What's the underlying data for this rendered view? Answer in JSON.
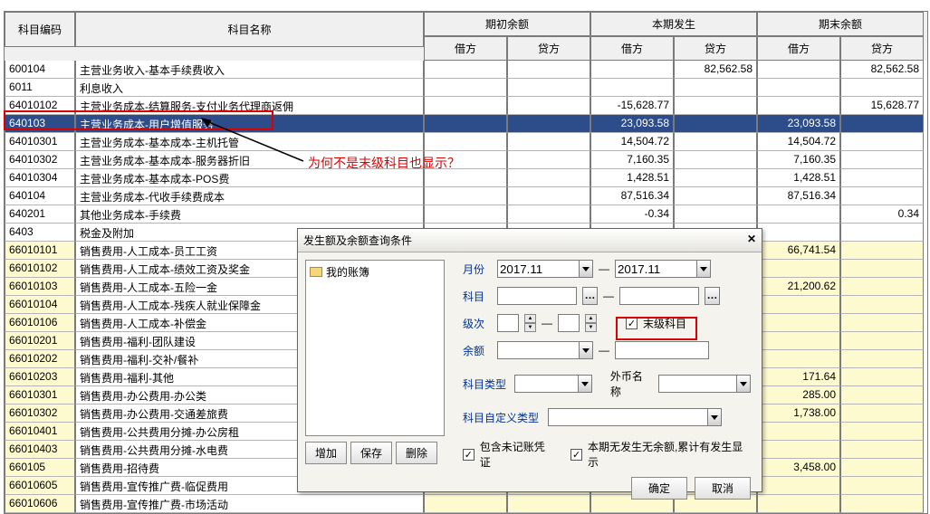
{
  "headers": {
    "code": "科目编码",
    "name": "科目名称",
    "qc": "期初余额",
    "bf": "本期发生",
    "qm": "期末余额",
    "debit": "借方",
    "credit": "贷方"
  },
  "rows": [
    {
      "code": "600104",
      "name": "    主营业务收入-基本手续费收入",
      "c": "white",
      "v": [
        "",
        "",
        "",
        "82,562.58",
        "",
        "82,562.58"
      ]
    },
    {
      "code": "6011",
      "name": "利息收入",
      "c": "white",
      "v": [
        "",
        "",
        "",
        "",
        "",
        ""
      ]
    },
    {
      "code": "64010102",
      "name": "       主营业务成本-结算服务-支付业务代理商返佣",
      "c": "white",
      "v": [
        "",
        "",
        "-15,628.77",
        "",
        "",
        "15,628.77"
      ]
    },
    {
      "code": "640103",
      "name": "    主营业务成本-用户增值服务",
      "c": "selected",
      "v": [
        "",
        "",
        "23,093.58",
        "",
        "23,093.58",
        ""
      ]
    },
    {
      "code": "64010301",
      "name": "       主营业务成本-基本成本-主机托管",
      "c": "white",
      "v": [
        "",
        "",
        "14,504.72",
        "",
        "14,504.72",
        ""
      ]
    },
    {
      "code": "64010302",
      "name": "       主营业务成本-基本成本-服务器折旧",
      "c": "white",
      "v": [
        "",
        "",
        "7,160.35",
        "",
        "7,160.35",
        ""
      ]
    },
    {
      "code": "64010304",
      "name": "       主营业务成本-基本成本-POS费",
      "c": "white",
      "v": [
        "",
        "",
        "1,428.51",
        "",
        "1,428.51",
        ""
      ]
    },
    {
      "code": "640104",
      "name": "    主营业务成本-代收手续费成本",
      "c": "white",
      "v": [
        "",
        "",
        "87,516.34",
        "",
        "87,516.34",
        ""
      ]
    },
    {
      "code": "640201",
      "name": "    其他业务成本-手续费",
      "c": "white",
      "v": [
        "",
        "",
        "-0.34",
        "",
        "",
        "0.34"
      ]
    },
    {
      "code": "6403",
      "name": "税金及附加",
      "c": "white",
      "v": [
        "",
        "",
        "",
        "",
        "",
        ""
      ]
    },
    {
      "code": "66010101",
      "name": "       销售费用-人工成本-员工工资",
      "c": "yellow",
      "v": [
        "",
        "",
        "",
        "",
        "66,741.54",
        ""
      ]
    },
    {
      "code": "66010102",
      "name": "       销售费用-人工成本-绩效工资及奖金",
      "c": "yellow",
      "v": [
        "",
        "",
        "",
        "",
        "",
        ""
      ]
    },
    {
      "code": "66010103",
      "name": "       销售费用-人工成本-五险一金",
      "c": "yellow",
      "v": [
        "",
        "",
        "",
        "",
        "21,200.62",
        ""
      ]
    },
    {
      "code": "66010104",
      "name": "       销售费用-人工成本-残疾人就业保障金",
      "c": "yellow",
      "v": [
        "",
        "",
        "",
        "",
        "",
        ""
      ]
    },
    {
      "code": "66010106",
      "name": "       销售费用-人工成本-补偿金",
      "c": "yellow",
      "v": [
        "",
        "",
        "",
        "",
        "",
        ""
      ]
    },
    {
      "code": "66010201",
      "name": "       销售费用-福利-团队建设",
      "c": "yellow",
      "v": [
        "",
        "",
        "",
        "",
        "",
        ""
      ]
    },
    {
      "code": "66010202",
      "name": "       销售费用-福利-交补/餐补",
      "c": "yellow",
      "v": [
        "",
        "",
        "",
        "",
        "",
        ""
      ]
    },
    {
      "code": "66010203",
      "name": "       销售费用-福利-其他",
      "c": "yellow",
      "v": [
        "",
        "",
        "",
        "",
        "171.64",
        ""
      ]
    },
    {
      "code": "66010301",
      "name": "       销售费用-办公费用-办公类",
      "c": "yellow",
      "v": [
        "",
        "",
        "",
        "",
        "285.00",
        ""
      ]
    },
    {
      "code": "66010302",
      "name": "       销售费用-办公费用-交通差旅费",
      "c": "yellow",
      "v": [
        "",
        "",
        "",
        "",
        "1,738.00",
        ""
      ]
    },
    {
      "code": "66010401",
      "name": "       销售费用-公共费用分摊-办公房租",
      "c": "yellow",
      "v": [
        "",
        "",
        "",
        "",
        "",
        ""
      ]
    },
    {
      "code": "66010403",
      "name": "       销售费用-公共费用分摊-水电费",
      "c": "yellow",
      "v": [
        "",
        "",
        "",
        "",
        "",
        ""
      ]
    },
    {
      "code": "660105",
      "name": "    销售费用-招待费",
      "c": "yellow",
      "v": [
        "",
        "",
        "",
        "",
        "3,458.00",
        ""
      ]
    },
    {
      "code": "66010605",
      "name": "       销售费用-宣传推广费-临促费用",
      "c": "yellow",
      "v": [
        "",
        "",
        "",
        "",
        "",
        ""
      ]
    },
    {
      "code": "66010606",
      "name": "       销售费用-宣传推广费-市场活动",
      "c": "yellow",
      "v": [
        "",
        "",
        "",
        "",
        "",
        ""
      ]
    }
  ],
  "annotation": "为何不是末级科目也显示？",
  "dialog": {
    "title": "发生额及余额查询条件",
    "treeItem": "我的账簿",
    "btnAdd": "增加",
    "btnSave": "保存",
    "btnDel": "删除",
    "lblMonth": "月份",
    "month1": "2017.11",
    "month2": "2017.11",
    "dash": "—",
    "lblSubject": "科目",
    "lblLevel": "级次",
    "lblLeaf": "末级科目",
    "lblBalance": "余额",
    "lblSubjectType": "科目类型",
    "lblCurrency": "外币名称",
    "lblCustomType": "科目自定义类型",
    "chkInclude": "包含未记账凭证",
    "chkNoBal": "本期无发生无余额,累计有发生显示",
    "btnOk": "确定",
    "btnCancel": "取消",
    "check": "✓"
  }
}
